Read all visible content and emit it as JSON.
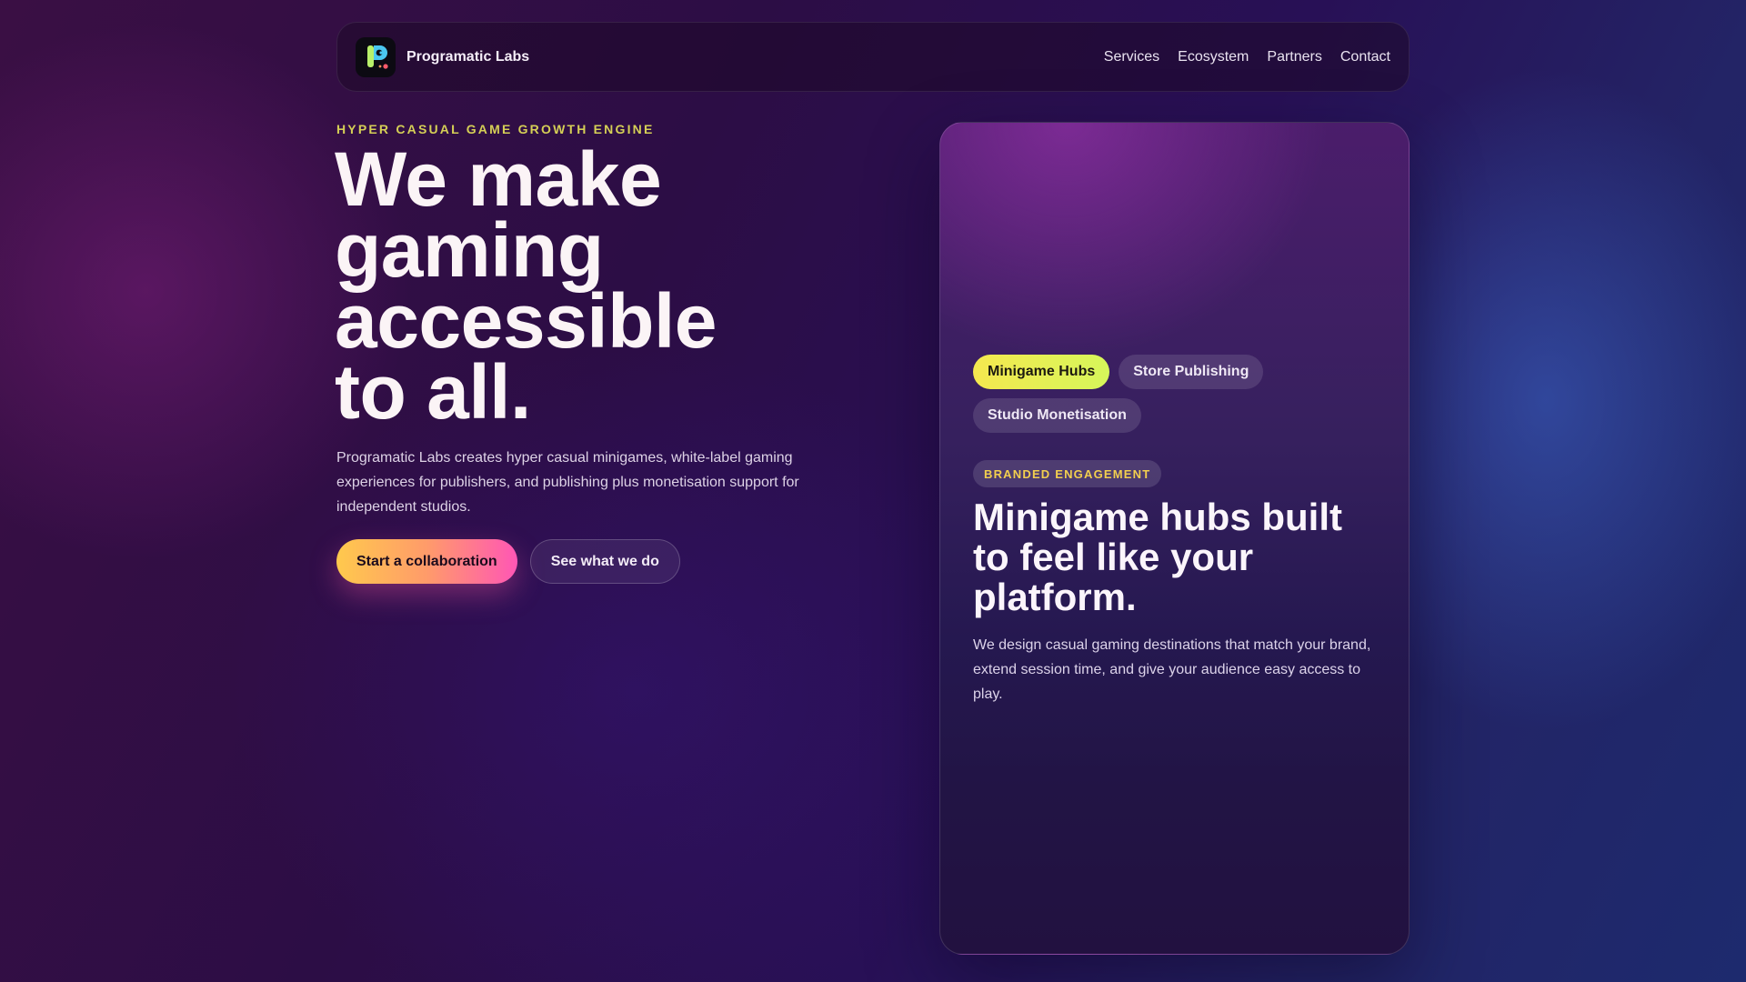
{
  "brand": {
    "name": "Programatic Labs",
    "logo_icon": "controller-p-logo-icon"
  },
  "nav": {
    "links": [
      "Services",
      "Ecosystem",
      "Partners",
      "Contact"
    ]
  },
  "hero": {
    "eyebrow": "HYPER CASUAL GAME GROWTH ENGINE",
    "headline_lines": [
      "We make",
      "gaming",
      "accessible",
      "to all."
    ],
    "lead": "Programatic Labs creates hyper casual minigames, white-label gaming experiences for publishers, and publishing plus monetisation support for independent studios.",
    "primary_cta": "Start a collaboration",
    "secondary_cta": "See what we do"
  },
  "card": {
    "tabs": [
      {
        "label": "Minigame Hubs",
        "active": true
      },
      {
        "label": "Store Publishing",
        "active": false
      },
      {
        "label": "Studio Monetisation",
        "active": false
      }
    ],
    "badge": "BRANDED ENGAGEMENT",
    "title": "Minigame hubs built to feel like your platform.",
    "text": "We design casual gaming destinations that match your brand, extend session time, and give your audience easy access to play."
  },
  "colors": {
    "accent_yellow": "#d5cf56",
    "cta_gradient_start": "#ffc94d",
    "cta_gradient_end": "#ff56b5",
    "active_tab": "#f5e84f",
    "badge_text": "#f2cf4e"
  }
}
